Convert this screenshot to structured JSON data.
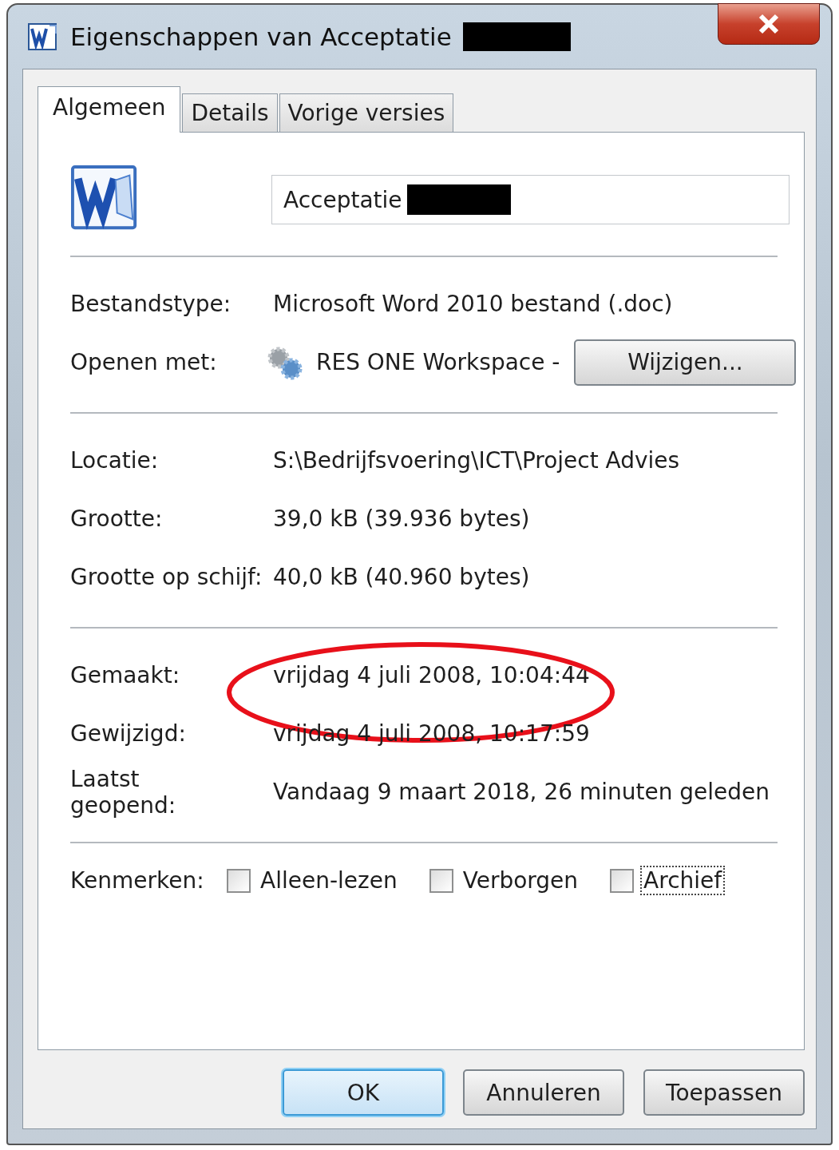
{
  "window": {
    "title": "Eigenschappen van Acceptatie",
    "title_redacted": true
  },
  "tabs": [
    {
      "label": "Algemeen",
      "selected": true
    },
    {
      "label": "Details",
      "selected": false
    },
    {
      "label": "Vorige versies",
      "selected": false
    }
  ],
  "file": {
    "name": "Acceptatie",
    "name_redacted": true
  },
  "sections": [
    {
      "kind": "type",
      "rows": [
        {
          "label": "Bestandstype:",
          "value": "Microsoft Word 2010 bestand (.doc)"
        },
        {
          "label": "Openen met:",
          "value": "RES ONE Workspace -",
          "button": "Wijzigen..."
        }
      ]
    },
    {
      "kind": "location",
      "rows": [
        {
          "label": "Locatie:",
          "value": "S:\\Bedrijfsvoering\\ICT\\Project Advies"
        },
        {
          "label": "Grootte:",
          "value": "39,0 kB (39.936 bytes)"
        },
        {
          "label": "Grootte op schijf:",
          "value": "40,0 kB (40.960 bytes)"
        }
      ]
    },
    {
      "kind": "dates",
      "rows": [
        {
          "label": "Gemaakt:",
          "value": "vrijdag 4 juli 2008, 10:04:44",
          "circled": true
        },
        {
          "label": "Gewijzigd:",
          "value": "vrijdag 4 juli 2008, 10:17:59",
          "circled": false
        },
        {
          "label": "Laatst geopend:",
          "value": "Vandaag 9 maart 2018, 26 minuten geleden",
          "circled": false
        }
      ]
    }
  ],
  "attributes": {
    "label": "Kenmerken:",
    "items": [
      {
        "label": "Alleen-lezen",
        "checked": false,
        "focused": false
      },
      {
        "label": "Verborgen",
        "checked": false,
        "focused": false
      },
      {
        "label": "Archief",
        "checked": false,
        "focused": true
      }
    ]
  },
  "annotation": {
    "color": "#e8101a"
  },
  "buttons": [
    {
      "label": "OK",
      "default": true
    },
    {
      "label": "Annuleren",
      "default": false
    },
    {
      "label": "Toepassen",
      "default": false
    }
  ]
}
